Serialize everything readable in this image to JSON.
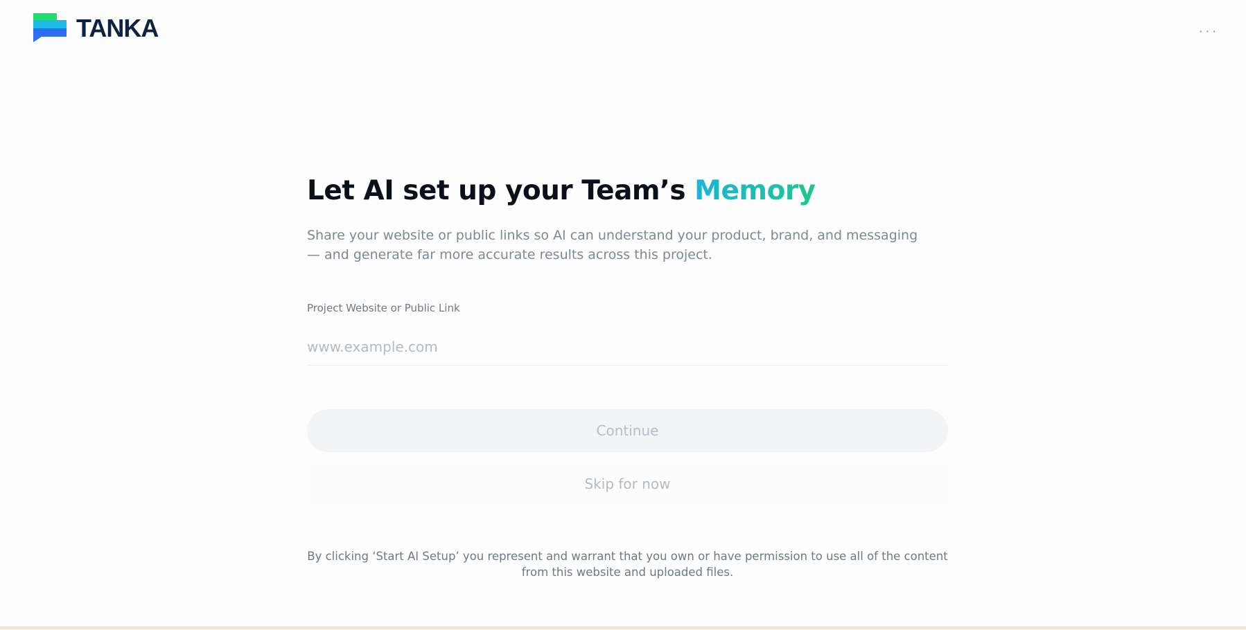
{
  "brand": {
    "name": "TANKA",
    "logo_colors": [
      "#22dd6f",
      "#1fb9e6",
      "#2f6df2"
    ],
    "logo_icon": "stacked-bars-chat-icon"
  },
  "header": {
    "more_menu_icon": "more-horizontal-icon",
    "more_menu_label": "···"
  },
  "main": {
    "title_prefix": "Let AI set up your Team’s ",
    "title_accent": "Memory",
    "accent_gradient": [
      "#1cb4d6",
      "#1ec78f"
    ],
    "subtitle": "Share your website or public links so AI can understand your product, brand, and messaging — and generate far more accurate results across this project.",
    "field": {
      "label": "Project Website or Public Link",
      "placeholder": "www.example.com",
      "value": ""
    },
    "continue_label": "Continue",
    "skip_label": "Skip for now",
    "disclaimer": "By clicking ‘Start AI Setup’ you represent and warrant that you own or have permission to use all of the content from this website and uploaded files."
  }
}
